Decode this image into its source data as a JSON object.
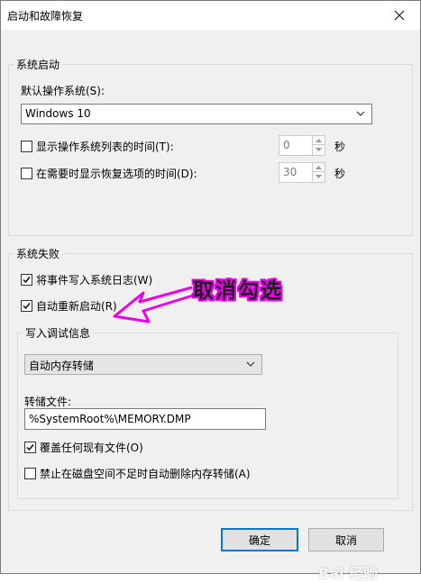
{
  "window": {
    "title": "启动和故障恢复",
    "close_icon": "close-icon"
  },
  "system_startup": {
    "legend": "系统启动",
    "default_os_label": "默认操作系统(S):",
    "default_os_value": "Windows 10",
    "show_os_list": {
      "label": "显示操作系统列表的时间(T):",
      "checked": false,
      "value": "0",
      "unit": "秒"
    },
    "show_recovery": {
      "label": "在需要时显示恢复选项的时间(D):",
      "checked": false,
      "value": "30",
      "unit": "秒"
    }
  },
  "system_failure": {
    "legend": "系统失败",
    "write_event_log": {
      "label": "将事件写入系统日志(W)",
      "checked": true
    },
    "auto_restart": {
      "label": "自动重新启动(R)",
      "checked": true
    },
    "debug": {
      "legend": "写入调试信息",
      "dump_type_value": "自动内存转储",
      "dump_file_label": "转储文件:",
      "dump_file_value": "%SystemRoot%\\MEMORY.DMP",
      "overwrite": {
        "label": "覆盖任何现有文件(O)",
        "checked": true
      },
      "disable_auto_delete": {
        "label": "禁止在磁盘空间不足时自动删除内存转储(A)",
        "checked": false
      }
    }
  },
  "buttons": {
    "ok": "确定",
    "cancel": "取消"
  },
  "annotation": {
    "text": "取消勾选",
    "color": "#e800e8"
  },
  "watermark": {
    "text": "Bai 经验"
  }
}
